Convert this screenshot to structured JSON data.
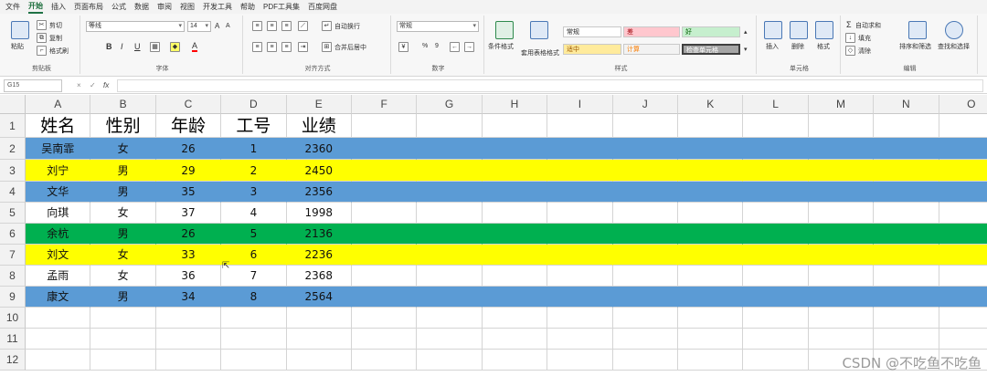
{
  "ribbon": {
    "tabs": [
      "文件",
      "开始",
      "插入",
      "页面布局",
      "公式",
      "数据",
      "审阅",
      "视图",
      "开发工具",
      "帮助",
      "PDF工具集",
      "百度网盘"
    ],
    "active_tab": "开始",
    "clipboard": {
      "cut": "剪切",
      "copy": "复制",
      "paste": "粘贴",
      "format_painter": "格式刷",
      "label": "剪贴板"
    },
    "font": {
      "name": "等线",
      "size": "14",
      "label": "字体",
      "bold": "B",
      "italic": "I",
      "underline": "U",
      "grow": "A",
      "shrink": "A",
      "color_letter": "A"
    },
    "alignment": {
      "wrap": "自动换行",
      "merge": "合并后居中",
      "label": "对齐方式"
    },
    "number": {
      "format": "常规",
      "percent": "%",
      "comma": "9",
      "label": "数字"
    },
    "styles": {
      "conditional": "条件格式",
      "table": "套用表格格式",
      "label": "样式",
      "cells": [
        "常规",
        "差",
        "好",
        "适中",
        "计算",
        "检查单元格"
      ]
    },
    "cells_group": {
      "insert": "插入",
      "delete": "删除",
      "format": "格式",
      "label": "单元格"
    },
    "editing": {
      "autosum": "自动求和",
      "fill": "填充",
      "clear": "清除",
      "sort": "排序和筛选",
      "find": "查找和选择",
      "label": "编辑"
    }
  },
  "formula_bar": {
    "name_box": "G15",
    "fx": "fx",
    "cancel": "×",
    "enter": "✓",
    "value": ""
  },
  "colors": {
    "blue": "#5b9bd5",
    "yellow": "#ffff00",
    "green": "#00b050",
    "white": "#ffffff"
  },
  "sheet": {
    "columns": [
      "A",
      "B",
      "C",
      "D",
      "E",
      "F",
      "G",
      "H",
      "I",
      "J",
      "K",
      "L",
      "M",
      "N",
      "O"
    ],
    "row_numbers": [
      "1",
      "2",
      "3",
      "4",
      "5",
      "6",
      "7",
      "8",
      "9",
      "10",
      "11",
      "12"
    ],
    "header": [
      "姓名",
      "性别",
      "年龄",
      "工号",
      "业绩"
    ],
    "rows": [
      {
        "values": [
          "吴南霏",
          "女",
          "26",
          "1",
          "2360"
        ],
        "fill": "blue"
      },
      {
        "values": [
          "刘宁",
          "男",
          "29",
          "2",
          "2450"
        ],
        "fill": "yellow"
      },
      {
        "values": [
          "文华",
          "男",
          "35",
          "3",
          "2356"
        ],
        "fill": "blue"
      },
      {
        "values": [
          "向琪",
          "女",
          "37",
          "4",
          "1998"
        ],
        "fill": "white"
      },
      {
        "values": [
          "余杭",
          "男",
          "26",
          "5",
          "2136"
        ],
        "fill": "green"
      },
      {
        "values": [
          "刘文",
          "女",
          "33",
          "6",
          "2236"
        ],
        "fill": "yellow"
      },
      {
        "values": [
          "孟雨",
          "女",
          "36",
          "7",
          "2368"
        ],
        "fill": "white"
      },
      {
        "values": [
          "康文",
          "男",
          "34",
          "8",
          "2564"
        ],
        "fill": "blue"
      }
    ]
  },
  "watermark": "CSDN @不吃鱼不吃鱼"
}
